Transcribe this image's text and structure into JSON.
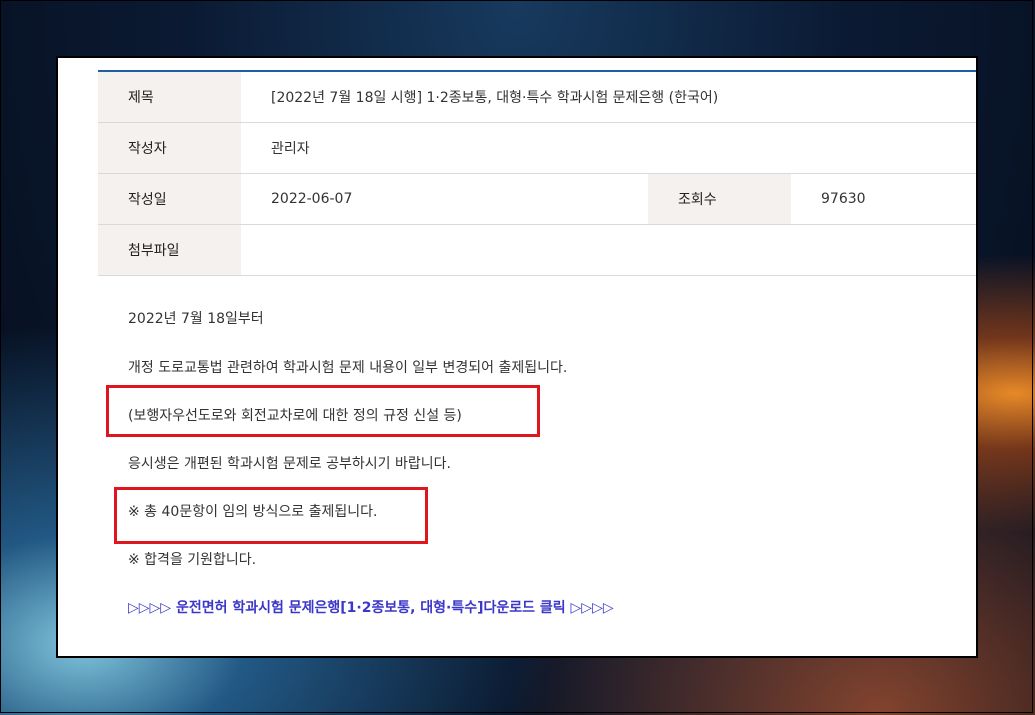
{
  "post": {
    "title_label": "제목",
    "title_value": "[2022년 7월 18일 시행] 1·2종보통, 대형·특수 학과시험 문제은행 (한국어)",
    "author_label": "작성자",
    "author_value": "관리자",
    "date_label": "작성일",
    "date_value": "2022-06-07",
    "views_label": "조회수",
    "views_value": "97630",
    "attach_label": "첨부파일",
    "attach_value": ""
  },
  "content": {
    "line1": "2022년 7월 18일부터",
    "line2": "개정 도로교통법 관련하여 학과시험 문제 내용이 일부 변경되어 출제됩니다.",
    "line3": "(보행자우선도로와 회전교차로에 대한 정의 규정 신설 등)",
    "line4": "응시생은 개편된 학과시험 문제로 공부하시기 바랍니다.",
    "line5": "※ 총 40문항이 임의 방식으로 출제됩니다.",
    "line6": "※ 합격을 기원합니다.",
    "download_link": "▷▷▷▷ 운전면허 학과시험 문제은행[1·2종보통, 대형·특수]다운로드 클릭 ▷▷▷▷"
  },
  "colors": {
    "highlight_box": "#e0161f",
    "link": "#3b37c8",
    "header_border": "#1f5fa8"
  }
}
